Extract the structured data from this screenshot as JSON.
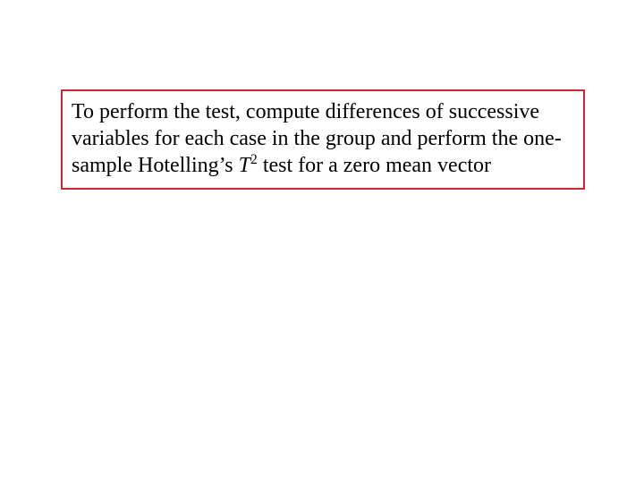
{
  "box": {
    "text_before_italic": "To perform the test, compute differences of successive variables for each case in the group and perform the one-sample Hotelling’s ",
    "italic_letter": "T",
    "superscript": "2",
    "text_after": " test for a zero mean vector"
  }
}
